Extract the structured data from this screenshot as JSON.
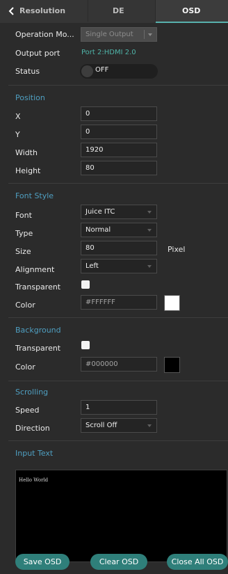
{
  "tabs": {
    "resolution": "Resolution",
    "de": "DE",
    "osd": "OSD"
  },
  "general": {
    "operation_mode_label": "Operation Mo...",
    "operation_mode_value": "Single Output",
    "output_port_label": "Output port",
    "output_port_value": "Port 2:HDMI 2.0",
    "status_label": "Status",
    "status_value": "OFF"
  },
  "position": {
    "title": "Position",
    "x_label": "X",
    "x_value": "0",
    "y_label": "Y",
    "y_value": "0",
    "width_label": "Width",
    "width_value": "1920",
    "height_label": "Height",
    "height_value": "80"
  },
  "font_style": {
    "title": "Font Style",
    "font_label": "Font",
    "font_value": "Juice ITC",
    "type_label": "Type",
    "type_value": "Normal",
    "size_label": "Size",
    "size_value": "80",
    "size_unit": "Pixel",
    "alignment_label": "Alignment",
    "alignment_value": "Left",
    "transparent_label": "Transparent",
    "color_label": "Color",
    "color_value": "#FFFFFF"
  },
  "background": {
    "title": "Background",
    "transparent_label": "Transparent",
    "color_label": "Color",
    "color_value": "#000000"
  },
  "scrolling": {
    "title": "Scrolling",
    "speed_label": "Speed",
    "speed_value": "1",
    "direction_label": "Direction",
    "direction_value": "Scroll Off"
  },
  "input_text": {
    "title": "Input Text",
    "value": "Hello World"
  },
  "buttons": {
    "save": "Save OSD",
    "clear": "Clear OSD",
    "close_all": "Close All OSD"
  },
  "colors": {
    "accent": "#4fb3a8",
    "section_title": "#4f9fc1",
    "button": "#2f7f7a"
  }
}
